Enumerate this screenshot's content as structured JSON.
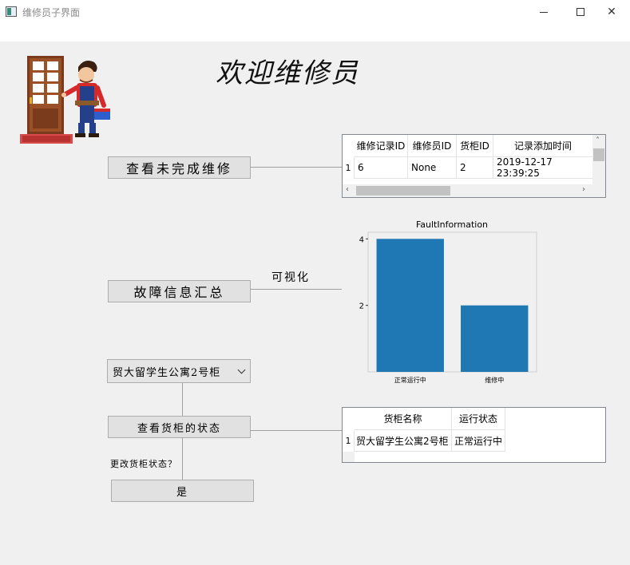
{
  "window": {
    "title": "维修员子界面",
    "controls": {
      "minimize": "—",
      "close": "✕"
    }
  },
  "welcome": "欢迎维修员",
  "buttons": {
    "view_unfinished": "查看未完成维修",
    "fault_summary": "故障信息汇总",
    "view_cabinet_status": "查看货柜的状态",
    "confirm_yes": "是"
  },
  "labels": {
    "visualize": "可视化",
    "change_status": "更改货柜状态？"
  },
  "combo": {
    "selected": "贸大留学生公寓2号柜"
  },
  "repair_table": {
    "headers": [
      "维修记录ID",
      "维修员ID",
      "货柜ID",
      "记录添加时间"
    ],
    "rows": [
      {
        "index": "1",
        "cells": [
          "6",
          "None",
          "2",
          "2019-12-17 23:39:25"
        ]
      }
    ]
  },
  "cabinet_table": {
    "headers": [
      "货柜名称",
      "运行状态"
    ],
    "rows": [
      {
        "index": "1",
        "cells": [
          "贸大留学生公寓2号柜",
          "正常运行中"
        ]
      }
    ]
  },
  "chart_data": {
    "type": "bar",
    "title": "FaultInformation",
    "categories": [
      "正常运行中",
      "维修中"
    ],
    "values": [
      4,
      2
    ],
    "yticks": [
      2,
      4
    ],
    "ylim": [
      0,
      4.2
    ],
    "bar_color": "#1f77b4"
  }
}
